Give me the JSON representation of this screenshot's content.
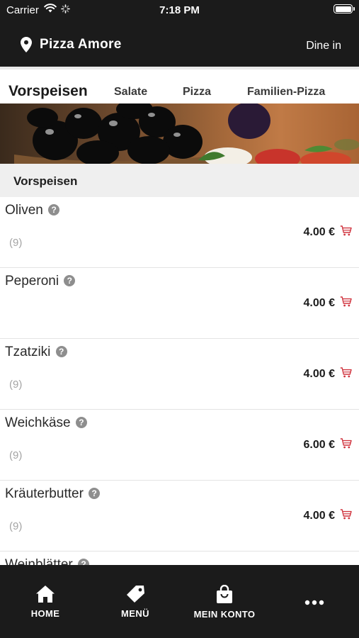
{
  "status_bar": {
    "carrier": "Carrier",
    "time": "7:18 PM"
  },
  "header": {
    "restaurant_name": "Pizza Amore",
    "mode": "Dine in"
  },
  "category_tabs": [
    {
      "label": "Vorspeisen",
      "active": true
    },
    {
      "label": "Salate",
      "active": false
    },
    {
      "label": "Pizza",
      "active": false
    },
    {
      "label": "Familien-Pizza",
      "active": false
    }
  ],
  "section": {
    "title": "Vorspeisen"
  },
  "menu_items": [
    {
      "name": "Oliven",
      "allergens": "(9)",
      "price": "4.00 €"
    },
    {
      "name": "Peperoni",
      "allergens": "",
      "price": "4.00 €"
    },
    {
      "name": "Tzatziki",
      "allergens": "(9)",
      "price": "4.00 €"
    },
    {
      "name": "Weichkäse",
      "allergens": "(9)",
      "price": "6.00 €"
    },
    {
      "name": "Kräuterbutter",
      "allergens": "(9)",
      "price": "4.00 €"
    },
    {
      "name": "Weinblätter",
      "allergens": "",
      "price": ""
    }
  ],
  "info_badge": "?",
  "bottom_nav": [
    {
      "label": "HOME",
      "icon": "home-icon"
    },
    {
      "label": "MENÜ",
      "icon": "tag-icon"
    },
    {
      "label": "MEIN KONTO",
      "icon": "shopping-bag-icon"
    },
    {
      "label": "",
      "icon": "more-icon"
    }
  ],
  "colors": {
    "bar_background": "#1b1b1b",
    "cart_accent": "#d0343f",
    "section_background": "#efefef"
  }
}
